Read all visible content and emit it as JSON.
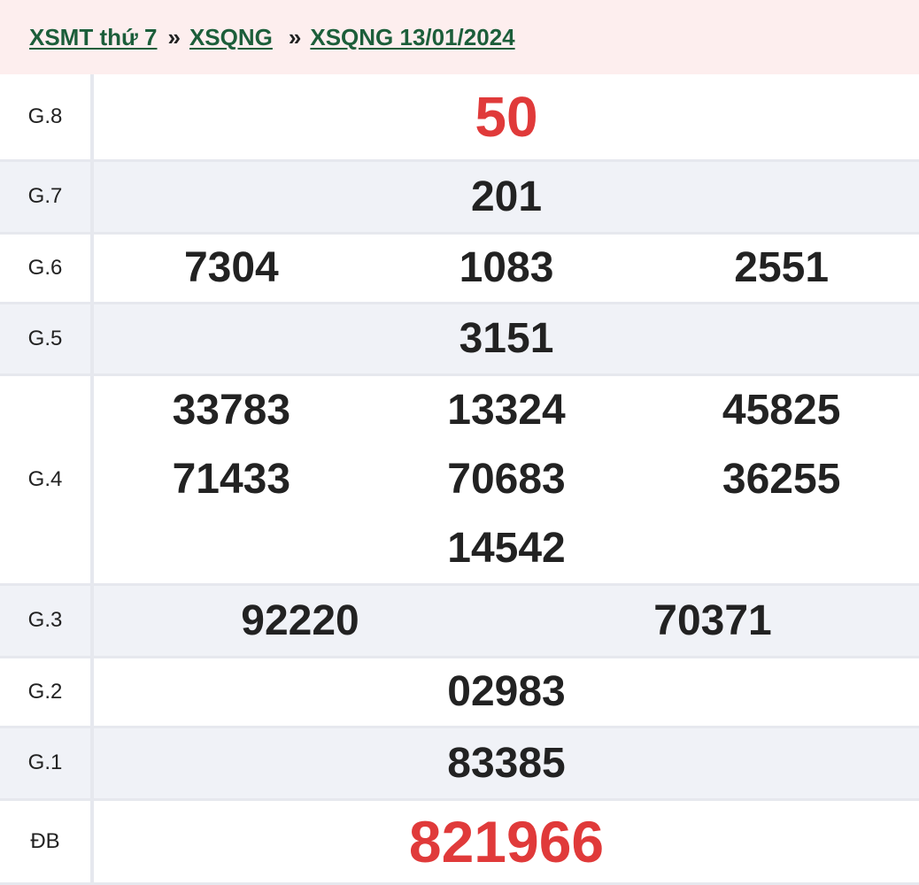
{
  "breadcrumb": {
    "item1": "XSMT thứ 7",
    "item2": "XSQNG",
    "item3": "XSQNG 13/01/2024",
    "separator": "»"
  },
  "rows": {
    "g8": {
      "label": "G.8",
      "numbers": [
        "50"
      ]
    },
    "g7": {
      "label": "G.7",
      "numbers": [
        "201"
      ]
    },
    "g6": {
      "label": "G.6",
      "numbers": [
        "7304",
        "1083",
        "2551"
      ]
    },
    "g5": {
      "label": "G.5",
      "numbers": [
        "3151"
      ]
    },
    "g4": {
      "label": "G.4",
      "numbers": [
        "33783",
        "13324",
        "45825",
        "71433",
        "70683",
        "36255",
        "14542"
      ]
    },
    "g3": {
      "label": "G.3",
      "numbers": [
        "92220",
        "70371"
      ]
    },
    "g2": {
      "label": "G.2",
      "numbers": [
        "02983"
      ]
    },
    "g1": {
      "label": "G.1",
      "numbers": [
        "83385"
      ]
    },
    "db": {
      "label": "ĐB",
      "numbers": [
        "821966"
      ]
    }
  },
  "colors": {
    "link": "#1c5e3a",
    "highlight": "#e03a3a",
    "breadcrumb_bg": "#fdeeee",
    "row_alt_bg": "#f0f2f7"
  }
}
